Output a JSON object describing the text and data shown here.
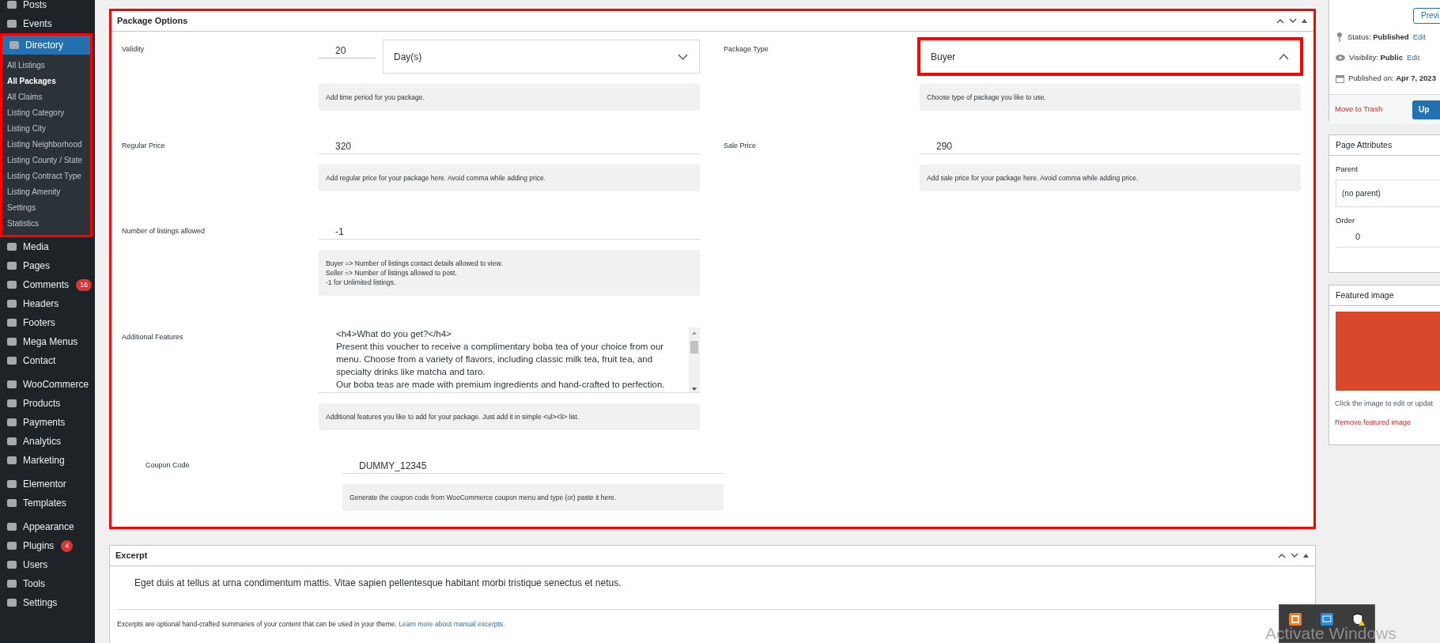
{
  "admin_menu": {
    "groups": [
      [
        {
          "label": "Posts",
          "selected": false,
          "annotated": false
        },
        {
          "label": "Events",
          "selected": false,
          "annotated": false
        },
        {
          "label": "Directory",
          "selected": true,
          "annotated": true,
          "submenu": [
            {
              "label": "All Listings",
              "selected": false
            },
            {
              "label": "All Packages",
              "selected": true
            },
            {
              "label": "All Claims",
              "selected": false
            },
            {
              "label": "Listing Category",
              "selected": false
            },
            {
              "label": "Listing City",
              "selected": false
            },
            {
              "label": "Listing Neighborhood",
              "selected": false
            },
            {
              "label": "Listing County / State",
              "selected": false
            },
            {
              "label": "Listing Contract Type",
              "selected": false
            },
            {
              "label": "Listing Amenity",
              "selected": false
            },
            {
              "label": "Settings",
              "selected": false
            },
            {
              "label": "Statistics",
              "selected": false
            }
          ]
        },
        {
          "label": "Media",
          "selected": false,
          "annotated": false
        },
        {
          "label": "Pages",
          "selected": false,
          "annotated": false
        },
        {
          "label": "Comments",
          "selected": false,
          "annotated": false,
          "badge": "16"
        },
        {
          "label": "Headers",
          "selected": false,
          "annotated": false
        },
        {
          "label": "Footers",
          "selected": false,
          "annotated": false
        },
        {
          "label": "Mega Menus",
          "selected": false,
          "annotated": false
        },
        {
          "label": "Contact",
          "selected": false,
          "annotated": false
        }
      ],
      [
        {
          "label": "WooCommerce",
          "selected": false,
          "annotated": false
        },
        {
          "label": "Products",
          "selected": false,
          "annotated": false
        },
        {
          "label": "Payments",
          "selected": false,
          "annotated": false
        },
        {
          "label": "Analytics",
          "selected": false,
          "annotated": false
        },
        {
          "label": "Marketing",
          "selected": false,
          "annotated": false
        }
      ],
      [
        {
          "label": "Elementor",
          "selected": false,
          "annotated": false
        },
        {
          "label": "Templates",
          "selected": false,
          "annotated": false
        }
      ],
      [
        {
          "label": "Appearance",
          "selected": false,
          "annotated": false
        },
        {
          "label": "Plugins",
          "selected": false,
          "annotated": false,
          "badge": "4"
        },
        {
          "label": "Users",
          "selected": false,
          "annotated": false
        },
        {
          "label": "Tools",
          "selected": false,
          "annotated": false
        },
        {
          "label": "Settings",
          "selected": false,
          "annotated": false
        }
      ]
    ]
  },
  "package_options": {
    "title": "Package Options",
    "annotated": true,
    "rows": [
      [
        {
          "kind": "number_select",
          "label": "Validity",
          "value": "20",
          "option": "Day(s)",
          "expanded": false,
          "annotated": false,
          "help": [
            "Add time period for you package."
          ]
        },
        {
          "kind": "select",
          "label": "Package Type",
          "option": "Buyer",
          "expanded": true,
          "annotated": true,
          "help": [
            "Choose type of package you like to use."
          ]
        }
      ],
      [
        {
          "kind": "text",
          "label": "Regular Price",
          "value": "320",
          "annotated": false,
          "help": [
            "Add regular price for your package here. Avoid comma while adding price."
          ]
        },
        {
          "kind": "text",
          "label": "Sale Price",
          "value": "290",
          "annotated": false,
          "help": [
            "Add sale price for your package here. Avoid comma while adding price."
          ]
        }
      ],
      [
        {
          "kind": "text",
          "label": "Number of listings allowed",
          "value": "-1",
          "annotated": false,
          "help": [
            "Buyer => Number of listings contact details allowed to view.",
            "Seller => Number of listings allowed to post.",
            "-1 for Unlimited listings."
          ]
        }
      ],
      [
        {
          "kind": "textarea",
          "label": "Additional Features",
          "value": "<h4>What do you get?</h4>\nPresent this voucher to receive a complimentary boba tea of your choice from our menu. Choose from a variety of flavors, including classic milk tea, fruit tea, and specialty drinks like matcha and taro.\nOur boba teas are made with premium ingredients and hand-crafted to perfection.",
          "annotated": false,
          "help": [
            "Additional features you like to add for your package. Just add it in simple <ul><li> list."
          ]
        }
      ],
      [
        {
          "kind": "text",
          "label": "Coupon Code",
          "value": "DUMMY_12345",
          "annotated": false,
          "indented": true,
          "help": [
            "Generate the coupon code from WooCommerce coupon menu and type (or) paste it here."
          ]
        }
      ]
    ]
  },
  "excerpt": {
    "title": "Excerpt",
    "value": "Eget duis at tellus at urna condimentum mattis. Vitae sapien pellentesque habitant morbi tristique senectus et netus.",
    "note": "Excerpts are optional hand-crafted summaries of your content that can be used in your theme.",
    "link": "Learn more about manual excerpts."
  },
  "publish": {
    "preview_button": "Previ",
    "lines": [
      {
        "label": "Status:",
        "value": "Published",
        "edit": "Edit"
      },
      {
        "label": "Visibility:",
        "value": "Public",
        "edit": "Edit"
      },
      {
        "label": "Published on:",
        "value": "Apr 7, 2023"
      }
    ],
    "trash_link": "Move to Trash",
    "update_button": "Up"
  },
  "page_attributes": {
    "title": "Page Attributes",
    "parent_label": "Parent",
    "parent_value": "(no parent)",
    "order_label": "Order",
    "order_value": "0"
  },
  "featured_image": {
    "title": "Featured image",
    "caption": "Click the image to edit or updat",
    "remove_link": "Remove featured image"
  },
  "system_notice": "Activate Windows"
}
